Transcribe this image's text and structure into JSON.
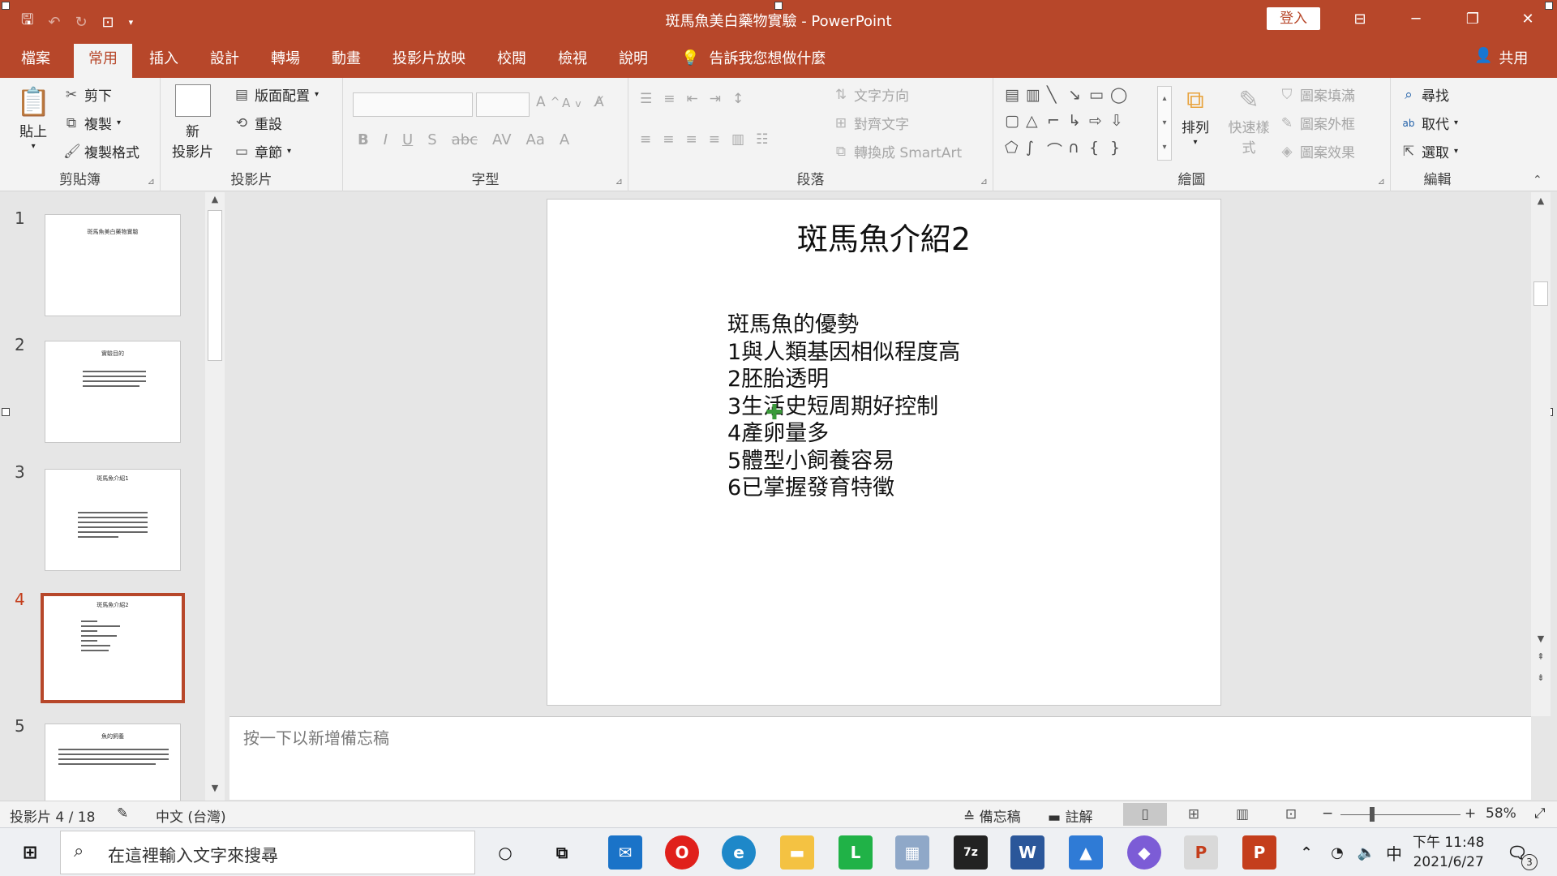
{
  "window": {
    "title": "斑馬魚美白藥物實驗 - PowerPoint",
    "login": "登入",
    "minimize": "─",
    "restore": "❐",
    "close": "✕"
  },
  "tabs": [
    {
      "label": "檔案"
    },
    {
      "label": "常用"
    },
    {
      "label": "插入"
    },
    {
      "label": "設計"
    },
    {
      "label": "轉場"
    },
    {
      "label": "動畫"
    },
    {
      "label": "投影片放映"
    },
    {
      "label": "校閱"
    },
    {
      "label": "檢視"
    },
    {
      "label": "說明"
    }
  ],
  "tellme": "告訴我您想做什麼",
  "share": "共用",
  "ribbon": {
    "clipboard": {
      "paste": "貼上",
      "cut": "剪下",
      "copy": "複製",
      "format_painter": "複製格式",
      "label": "剪貼簿"
    },
    "slides": {
      "new_slide_1": "新",
      "new_slide_2": "投影片",
      "layout": "版面配置",
      "reset": "重設",
      "section": "章節",
      "label": "投影片"
    },
    "font": {
      "label": "字型"
    },
    "paragraph": {
      "text_direction": "文字方向",
      "align_text": "對齊文字",
      "smartart": "轉換成 SmartArt",
      "label": "段落"
    },
    "drawing": {
      "arrange": "排列",
      "quick_styles": "快速樣式",
      "shape_fill": "圖案填滿",
      "shape_outline": "圖案外框",
      "shape_effects": "圖案效果",
      "label": "繪圖"
    },
    "editing": {
      "find": "尋找",
      "replace": "取代",
      "select": "選取",
      "label": "編輯"
    }
  },
  "thumbnails": [
    {
      "num": "1",
      "title": "斑馬魚美白藥物實驗"
    },
    {
      "num": "2",
      "title": "實驗目的"
    },
    {
      "num": "3",
      "title": "斑馬魚介紹1"
    },
    {
      "num": "4",
      "title": "斑馬魚介紹2"
    },
    {
      "num": "5",
      "title": "魚的飼養"
    }
  ],
  "slide": {
    "title": "斑馬魚介紹2",
    "lines": [
      "斑馬魚的優勢",
      "1與人類基因相似程度高",
      "2胚胎透明",
      "3生活史短周期好控制",
      "4產卵量多",
      "5體型小飼養容易",
      "6已掌握發育特徵"
    ]
  },
  "notes_placeholder": "按一下以新增備忘稿",
  "status": {
    "slide_indicator": "投影片 4 / 18",
    "language": "中文 (台灣)",
    "notes": "備忘稿",
    "comments": "註解",
    "zoom_percent": "58%",
    "zoom_level": 0.58
  },
  "taskbar": {
    "search_placeholder": "在這裡輸入文字來搜尋",
    "ime": "中",
    "time": "下午 11:48",
    "date": "2021/6/27",
    "notification_count": "3"
  }
}
